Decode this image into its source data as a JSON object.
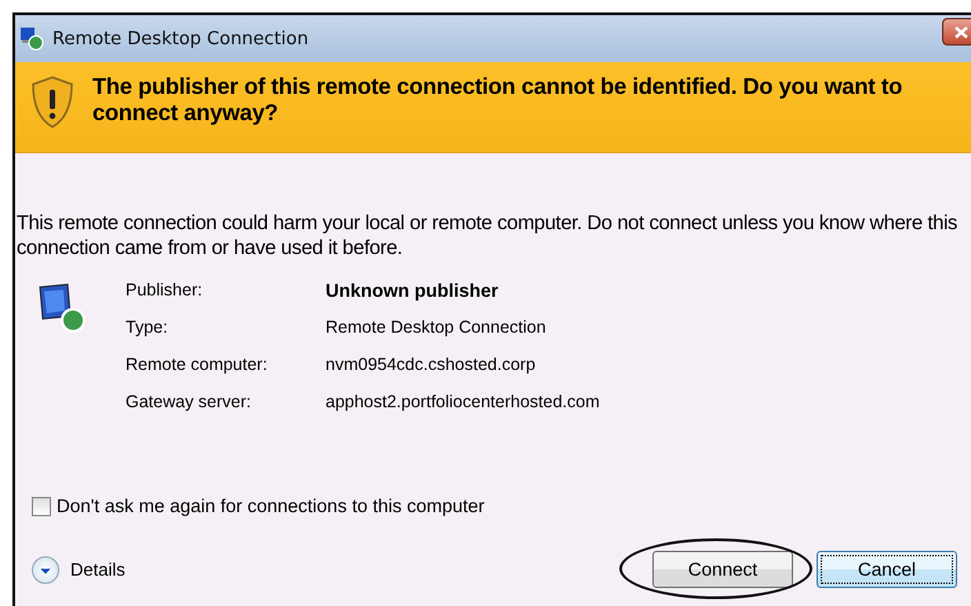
{
  "window": {
    "title": "Remote Desktop Connection"
  },
  "banner": {
    "heading": "The publisher of this remote connection cannot be identified. Do you want to connect anyway?"
  },
  "message": "This remote connection could harm your local or remote computer. Do not connect unless you know where this connection came from or have used it before.",
  "details": [
    {
      "label": "Publisher:",
      "value": "Unknown publisher",
      "emphasis": true
    },
    {
      "label": "Type:",
      "value": "Remote Desktop Connection",
      "emphasis": false
    },
    {
      "label": "Remote computer:",
      "value": "nvm0954cdc.cshosted.corp",
      "emphasis": false
    },
    {
      "label": "Gateway server:",
      "value": "apphost2.portfoliocenterhosted.com",
      "emphasis": false
    }
  ],
  "checkbox": {
    "label": "Don't ask me again for connections to this computer",
    "checked": false
  },
  "details_toggle": {
    "label": "Details",
    "expanded": false
  },
  "buttons": [
    {
      "label": "Connect",
      "focused": false,
      "circled": true
    },
    {
      "label": "Cancel",
      "focused": true,
      "circled": false
    }
  ]
}
